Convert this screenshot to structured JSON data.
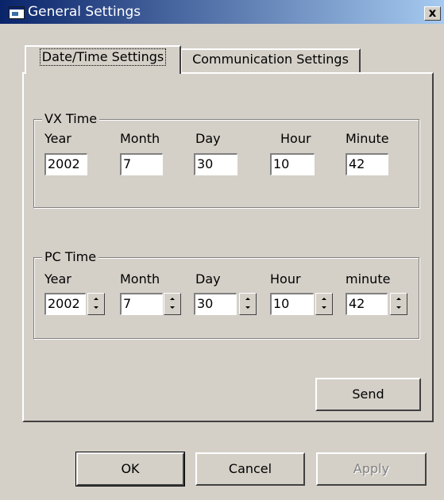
{
  "window": {
    "title": "General Settings",
    "icon": "app-window-icon",
    "close_label": "x"
  },
  "tabs": [
    {
      "label": "Date/Time Settings",
      "active": true
    },
    {
      "label": "Communication Settings",
      "active": false
    }
  ],
  "vx_time": {
    "title": "VX Time",
    "labels": {
      "year": "Year",
      "month": "Month",
      "day": "Day",
      "hour": "Hour",
      "minute": "Minute"
    },
    "values": {
      "year": "2002",
      "month": "7",
      "day": "30",
      "hour": "10",
      "minute": "42"
    }
  },
  "pc_time": {
    "title": "PC Time",
    "labels": {
      "year": "Year",
      "month": "Month",
      "day": "Day",
      "hour": "Hour",
      "minute": "minute"
    },
    "values": {
      "year": "2002",
      "month": "7",
      "day": "30",
      "hour": "10",
      "minute": "42"
    }
  },
  "buttons": {
    "send": "Send",
    "ok": "OK",
    "cancel": "Cancel",
    "apply": "Apply"
  },
  "colors": {
    "titlebar_start": "#0a246a",
    "titlebar_end": "#a6caf0",
    "face": "#d4d0c8"
  }
}
